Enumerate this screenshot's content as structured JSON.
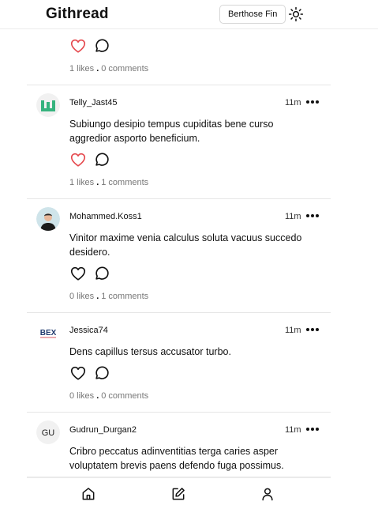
{
  "app": {
    "title": "Githread",
    "user_button_label": "Berthose Fin"
  },
  "header": {
    "theme_icon": "sun-icon"
  },
  "colors": {
    "liked": "#e5484d",
    "muted_text": "#777777",
    "divider": "#e6e6e6"
  },
  "posts": [
    {
      "liked": true,
      "likes_label": "1 likes",
      "separator": ".",
      "comments_label": "0 comments"
    },
    {
      "username": "Telly_Jast45",
      "time": "11m",
      "body": "Subiungo desipio tempus cupiditas bene curso aggredior asporto beneficium.",
      "liked": true,
      "likes_label": "1 likes",
      "separator": ".",
      "comments_label": "1 comments",
      "avatar": "green-logo-avatar"
    },
    {
      "username": "Mohammed.Koss1",
      "time": "11m",
      "body": "Vinitor maxime venia calculus soluta vacuus succedo desidero.",
      "liked": false,
      "likes_label": "0 likes",
      "separator": ".",
      "comments_label": "1 comments",
      "avatar": "photo-avatar"
    },
    {
      "username": "Jessica74",
      "time": "11m",
      "body": "Dens capillus tersus accusator turbo.",
      "liked": false,
      "likes_label": "0 likes",
      "separator": ".",
      "comments_label": "0 comments",
      "avatar": "bex-logo-avatar",
      "avatar_text": "BEX"
    },
    {
      "username": "Gudrun_Durgan2",
      "time": "11m",
      "body": "Cribro peccatus adinventitias terga caries asper voluptatem brevis paens defendo fuga possimus.",
      "avatar": "initials-avatar",
      "avatar_text": "GU"
    }
  ],
  "bottom_nav": {
    "items": [
      "home-icon",
      "edit-icon",
      "profile-icon"
    ]
  }
}
